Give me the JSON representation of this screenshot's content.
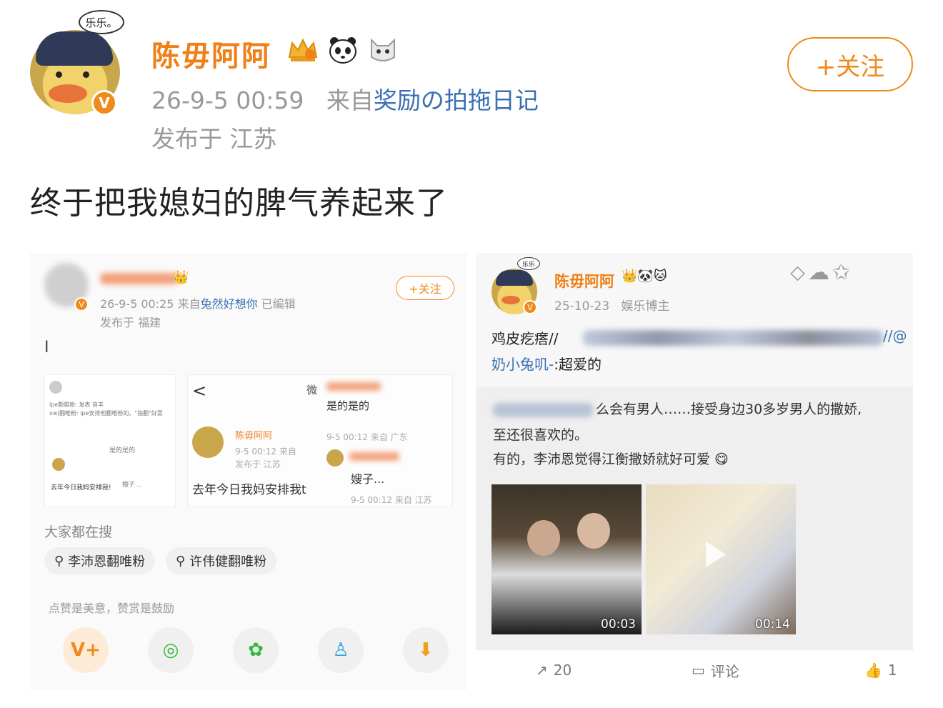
{
  "header": {
    "avatar_bubble": "乐乐。",
    "username": "陈毋阿阿",
    "badges": [
      "crown-badge-icon",
      "panda-icon",
      "cat-icon"
    ],
    "verified_mark": "V",
    "timestamp": "26-9-5 00:59",
    "source_prefix": "来自",
    "source": "奖励の拍拖日记",
    "location": "发布于 江苏",
    "follow_label": "+关注"
  },
  "post": {
    "text": "终于把我媳妇的脾气养起来了"
  },
  "left_screenshot": {
    "timestamp": "26-9-5 00:25",
    "source_prefix": "来自",
    "source": "兔然好想你",
    "edited": "已编辑",
    "location": "发布于 福建",
    "follow_label": "+关注",
    "cursor_text": "I",
    "thumb1": {
      "line1": "lpe颤雄粉: 发表 音丰",
      "line2": "xw|翻唯粉: lpe安排他翻唯粉的。\"指翻\"好耍",
      "inner_text": "是的是的",
      "inner_sub": "嫂子...",
      "caption": "去年今日我妈安排我!"
    },
    "thumb2": {
      "back": "<",
      "side_char": "微",
      "reply_text": "是的是的",
      "time": "9-5 00:12",
      "loc": "来自 广东",
      "name": "陈毋阿阿",
      "date": "9-5 00:12",
      "from": "来自",
      "from_loc": "发布于 江苏",
      "caption": "去年今日我妈安排我t",
      "reply2_text": "嫂子...",
      "reply2_time": "9-5 00:12",
      "reply2_loc": "来自 江苏"
    },
    "search_title": "大家都在搜",
    "chips": [
      "李沛恩翻唯粉",
      "许伟健翻唯粉"
    ],
    "praise_text": "点赞是美意，赞赏是鼓励",
    "share_icons": [
      "v-plus-icon",
      "wechat-icon",
      "moments-icon",
      "qq-icon",
      "save-image-icon"
    ]
  },
  "right_screenshot": {
    "avatar_bubble": "乐乐",
    "username": "陈毋阿阿",
    "date": "25-10-23",
    "tag": "娱乐博主",
    "line1": "鸡皮疙瘩//",
    "line1_tail": "//@",
    "line2": "奶小兔叽-:超爱的",
    "quote_line1_tail": "么会有男人……接受身边30多岁男人的撒娇,",
    "quote_line2": "至还很喜欢的。",
    "quote_line3": "有的，李沛恩觉得江衡撒娇就好可爱",
    "videos": [
      {
        "duration": "00:03"
      },
      {
        "duration": "00:14"
      }
    ],
    "footer": {
      "repost_count": "20",
      "comment_label": "评论",
      "like_count": "1"
    }
  }
}
